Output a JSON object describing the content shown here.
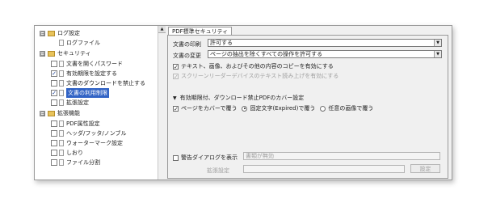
{
  "tree": {
    "items": [
      {
        "label": "ログ設定",
        "expander": "⊟",
        "type": "folder"
      },
      {
        "label": "ログファイル",
        "type": "page"
      },
      {
        "label": "セキュリティ",
        "expander": "⊟",
        "type": "folder"
      },
      {
        "label": "文書を開くパスワード",
        "checked": false
      },
      {
        "label": "有効期限を設定する",
        "checked": true
      },
      {
        "label": "文書のダウンロードを禁止する",
        "checked": false
      },
      {
        "label": "文書の利用制限",
        "checked": true,
        "selected": true
      },
      {
        "label": "拡張設定",
        "checked": false
      },
      {
        "label": "拡張機能",
        "expander": "⊟",
        "type": "folder"
      },
      {
        "label": "PDF属性設定",
        "checked": false
      },
      {
        "label": "ヘッダ/フッタ/ノンブル",
        "checked": false
      },
      {
        "label": "ウォーターマーク設定",
        "checked": false
      },
      {
        "label": "しおり",
        "checked": false
      },
      {
        "label": "ファイル分割",
        "checked": false
      }
    ]
  },
  "scroll_up_glyph": "▲",
  "tab": {
    "label": "PDF標準セキュリティ"
  },
  "print": {
    "label": "文書の印刷",
    "value": "許可する"
  },
  "change": {
    "label": "文書の変更",
    "value": "ページの抽出を除くすべての操作を許可する"
  },
  "copy_text": {
    "label": "テキスト、画像、およびその他の内容のコピーを有効にする",
    "checked": true
  },
  "screen_reader": {
    "label": "スクリーンリーダーデバイスのテキスト読み上げを有効にする",
    "checked": true
  },
  "cover_section": {
    "label": "有効期限付、ダウンロード禁止PDFのカバー設定"
  },
  "cover_page": {
    "label": "ページをカバーで覆う",
    "checked": true
  },
  "fixed_text": {
    "label": "固定文字(Expired)で覆う",
    "selected": true
  },
  "any_image": {
    "label": "任意の画像で覆う",
    "selected": false
  },
  "warning": {
    "label": "警告ダイアログを表示",
    "checked": false,
    "value": "書類が無効"
  },
  "extension": {
    "label": "拡張設定",
    "button": "設定"
  },
  "arrow_glyph": "▼",
  "check_glyph": "✓"
}
